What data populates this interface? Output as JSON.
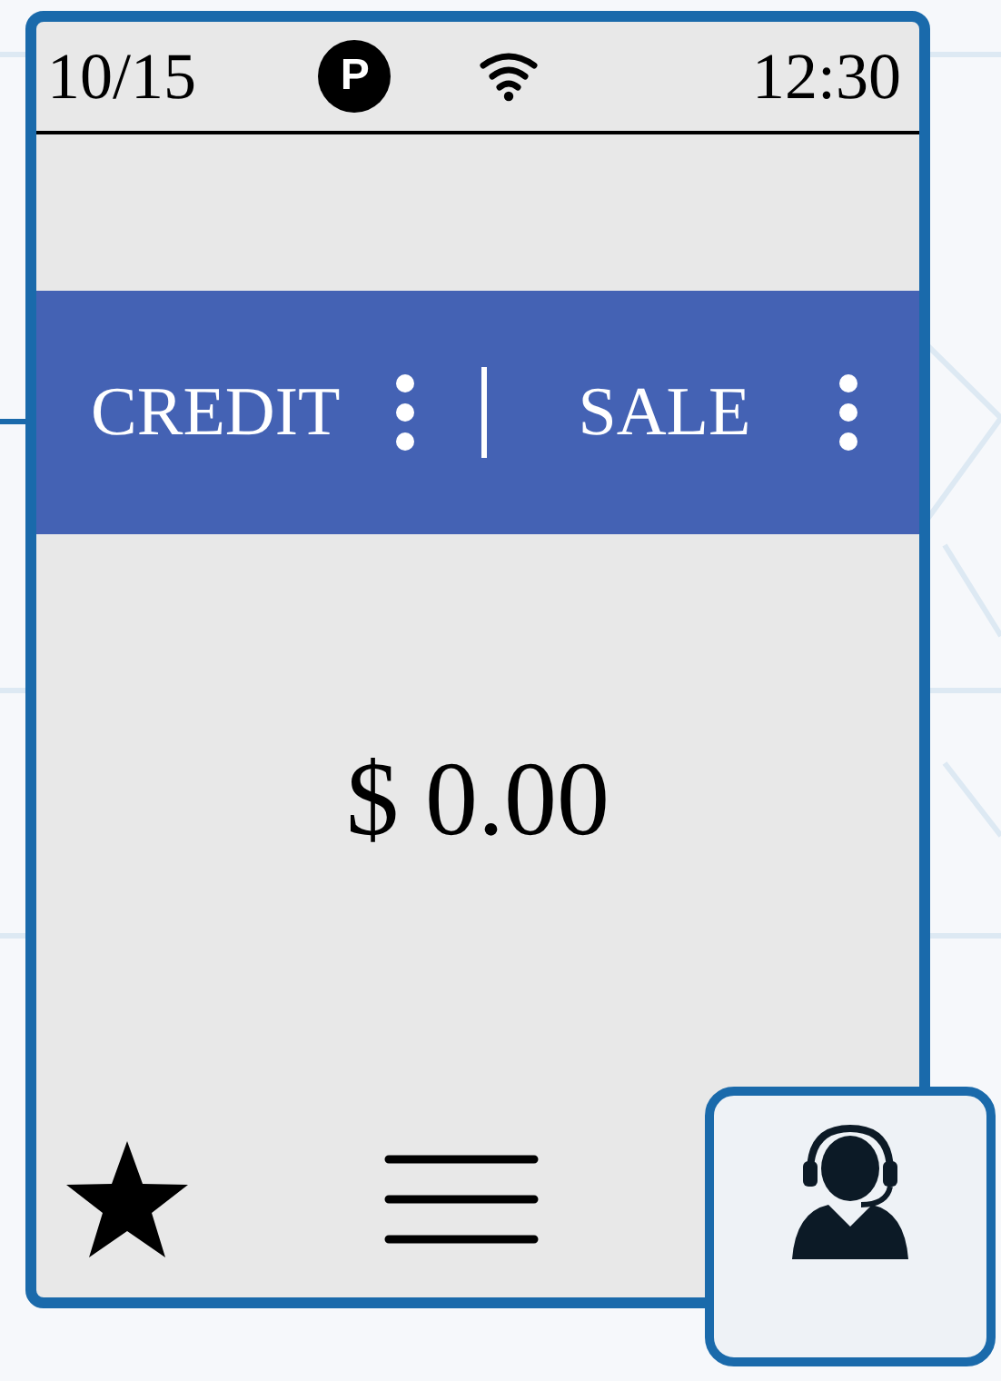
{
  "status_bar": {
    "date": "10/15",
    "badge": "P",
    "time": "12:30"
  },
  "transaction": {
    "type": "CREDIT",
    "mode": "SALE"
  },
  "amount": "$ 0.00",
  "bottom_bar": [
    {
      "kind": "favorites",
      "selected": false
    },
    {
      "kind": "menu",
      "selected": false
    },
    {
      "kind": "support",
      "selected": true
    }
  ]
}
